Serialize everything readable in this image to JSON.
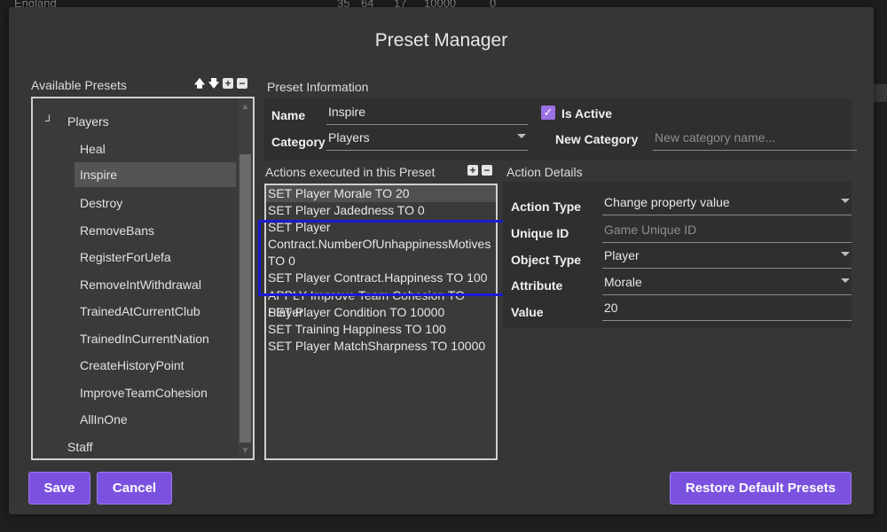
{
  "background_row": {
    "country": "England",
    "c1": "35",
    "c2": "64",
    "c3": "17",
    "c4": "10000",
    "c5": "0"
  },
  "dialog": {
    "title": "Preset Manager"
  },
  "available_presets": {
    "label": "Available Presets",
    "icons": [
      "arrow-up-icon",
      "arrow-down-icon",
      "plus-box-icon",
      "minus-box-icon"
    ],
    "expander_glyph": "┘",
    "tree": [
      {
        "label": "Players",
        "level": 0
      },
      {
        "label": "Heal",
        "level": 1
      },
      {
        "label": "Inspire",
        "level": 1,
        "selected": true
      },
      {
        "label": "Destroy",
        "level": 1
      },
      {
        "label": "RemoveBans",
        "level": 1
      },
      {
        "label": "RegisterForUefa",
        "level": 1
      },
      {
        "label": "RemoveIntWithdrawal",
        "level": 1
      },
      {
        "label": "TrainedAtCurrentClub",
        "level": 1
      },
      {
        "label": "TrainedInCurrentNation",
        "level": 1
      },
      {
        "label": "CreateHistoryPoint",
        "level": 1
      },
      {
        "label": "ImproveTeamCohesion",
        "level": 1
      },
      {
        "label": "AllInOne",
        "level": 1
      },
      {
        "label": "Staff",
        "level": 0
      }
    ]
  },
  "preset_info": {
    "label": "Preset Information",
    "name_label": "Name",
    "name_value": "Inspire",
    "is_active_label": "Is Active",
    "is_active": true,
    "category_label": "Category",
    "category_value": "Players",
    "new_category_label": "New Category",
    "new_category_placeholder": "New category name..."
  },
  "actions": {
    "label": "Actions executed in this Preset",
    "icons": [
      "plus-box-icon",
      "minus-box-icon"
    ],
    "items": [
      "SET Player Morale TO 20",
      "SET Player Jadedness TO 0",
      "SET Player",
      "Contract.NumberOfUnhappinessMotives",
      "TO 0",
      "SET Player Contract.Happiness TO 100",
      "APPLY Improve Team Cohesion TO Player",
      "SET Player Condition TO 10000",
      "SET Training Happiness TO 100",
      "SET Player MatchSharpness TO 10000"
    ]
  },
  "action_details": {
    "label": "Action Details",
    "action_type_label": "Action Type",
    "action_type_value": "Change property value",
    "unique_id_label": "Unique ID",
    "unique_id_placeholder": "Game Unique ID",
    "object_type_label": "Object Type",
    "object_type_value": "Player",
    "attribute_label": "Attribute",
    "attribute_value": "Morale",
    "value_label": "Value",
    "value_value": "20"
  },
  "buttons": {
    "save": "Save",
    "cancel": "Cancel",
    "restore": "Restore Default Presets"
  },
  "colors": {
    "accent": "#7b52e0",
    "highlight": "#1a1ad6",
    "dialog_bg": "#363636"
  }
}
